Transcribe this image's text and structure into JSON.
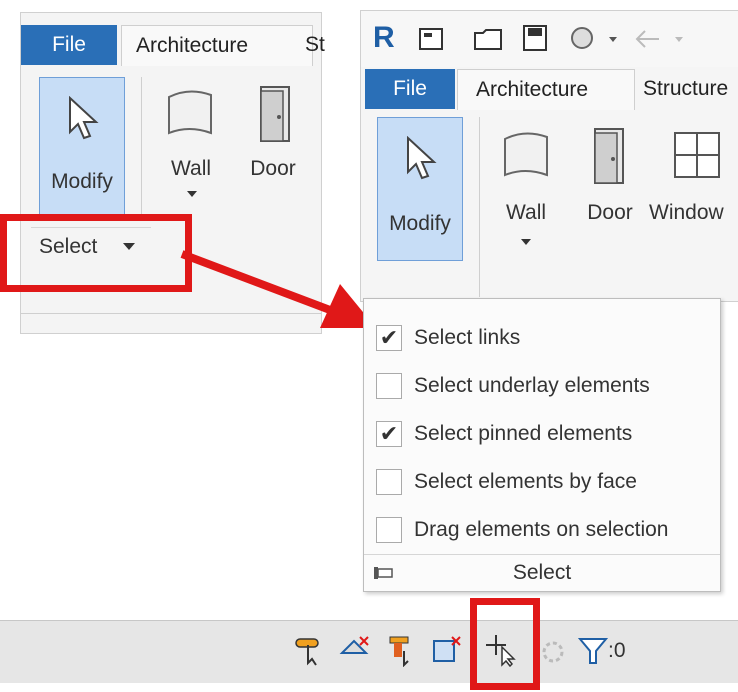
{
  "left_ribbon": {
    "tabs": [
      "File",
      "Architecture",
      "St"
    ],
    "buttons": {
      "modify": "Modify",
      "wall": "Wall",
      "door": "Door"
    },
    "panel_label": "Select"
  },
  "right_ribbon": {
    "app_logo": "R",
    "tabs": [
      "File",
      "Architecture",
      "Structure"
    ],
    "buttons": {
      "modify": "Modify",
      "wall": "Wall",
      "door": "Door",
      "window": "Window"
    }
  },
  "select_menu": {
    "items": [
      {
        "label": "Select links",
        "checked": true
      },
      {
        "label": "Select underlay elements",
        "checked": false
      },
      {
        "label": "Select pinned elements",
        "checked": true
      },
      {
        "label": "Select elements by face",
        "checked": false
      },
      {
        "label": "Drag elements on selection",
        "checked": false
      }
    ],
    "footer": "Select"
  },
  "status_bar": {
    "filter_count": ":0"
  },
  "colors": {
    "accent_red": "#e01818",
    "file_tab_blue": "#2a6fb7",
    "modify_blue": "#c7ddf6"
  },
  "icons": [
    "modify-cursor-icon",
    "wall-icon",
    "door-icon",
    "window-icon",
    "folder-icon",
    "save-icon",
    "undo-icon",
    "filter-icon"
  ]
}
